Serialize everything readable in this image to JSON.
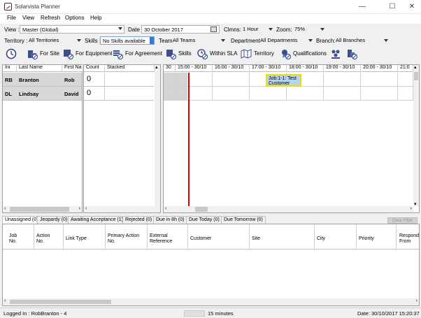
{
  "window": {
    "title": "Solarvista Planner",
    "minimize": "—",
    "maximize": "☐",
    "close": "✕"
  },
  "menu": [
    "File",
    "View",
    "Refresh",
    "Options",
    "Help"
  ],
  "filters": {
    "view_label": "View :",
    "view_value": "Master (Global)",
    "date_label": "Date :",
    "date_value": "30  October  2017",
    "columns_label": "Clmns:",
    "columns_value": "1 Hour",
    "zoom_label": "Zoom:",
    "zoom_value": "75%",
    "territory_label": "Territory :",
    "territory_value": "All Territories",
    "skills_label": "Skills :",
    "skills_value": "No Skills available",
    "team_label": "Team",
    "team_value": "All Teams",
    "department_label": "Department",
    "department_value": "All Departments",
    "branch_label": "Branch:",
    "branch_value": "All Branches"
  },
  "toolbar": {
    "for_site": "For Site",
    "for_equipment": "For Equipment",
    "for_agreement": "For Agreement",
    "skills": "Skills",
    "within_sla": "Within SLA",
    "territory": "Territory",
    "qualifications": "Qualifications"
  },
  "engineers": {
    "columns": [
      "Ini",
      "Last Name",
      "First Na"
    ],
    "rows": [
      {
        "ini": "RB",
        "last": "Branton",
        "first": "Rob"
      },
      {
        "ini": "DL",
        "last": "Lindsay",
        "first": "David"
      }
    ]
  },
  "counts": {
    "columns": [
      "Count",
      "Stacked"
    ],
    "values": [
      "0",
      "0"
    ]
  },
  "timeline": {
    "columns": [
      "30",
      "15:00 - 30/10",
      "16:00 - 30/10",
      "17:00 - 30/10",
      "18:00 - 30/10",
      "19:00 - 30/10",
      "20:00 - 30/10",
      "21:0"
    ],
    "job_line1": "Job:1-1: Test",
    "job_line2": "Customer"
  },
  "tabs": [
    "Unassigned (0)",
    "Jeopardy (0)",
    "Awaiting Acceptance (1)",
    "Rejected (0)",
    "Due in 8h (0)",
    "Due Today (0)",
    "Due Tomorrow (0)"
  ],
  "clear_filter": "Clear Filter",
  "jobs_table": {
    "columns": [
      {
        "l1": "Job",
        "l2": "No."
      },
      {
        "l1": "Action",
        "l2": "No."
      },
      {
        "l1": "Link Type",
        "l2": ""
      },
      {
        "l1": "Primary Action",
        "l2": "No."
      },
      {
        "l1": "External",
        "l2": "Reference"
      },
      {
        "l1": "Customer",
        "l2": ""
      },
      {
        "l1": "Site",
        "l2": ""
      },
      {
        "l1": "City",
        "l2": ""
      },
      {
        "l1": "Priority",
        "l2": ""
      },
      {
        "l1": "Respond",
        "l2": "From"
      }
    ]
  },
  "status": {
    "logged_in": "Logged In : RobBranton - 4",
    "interval": "15 minutes",
    "date": "Date: 30/10/2017 15:20:37"
  }
}
